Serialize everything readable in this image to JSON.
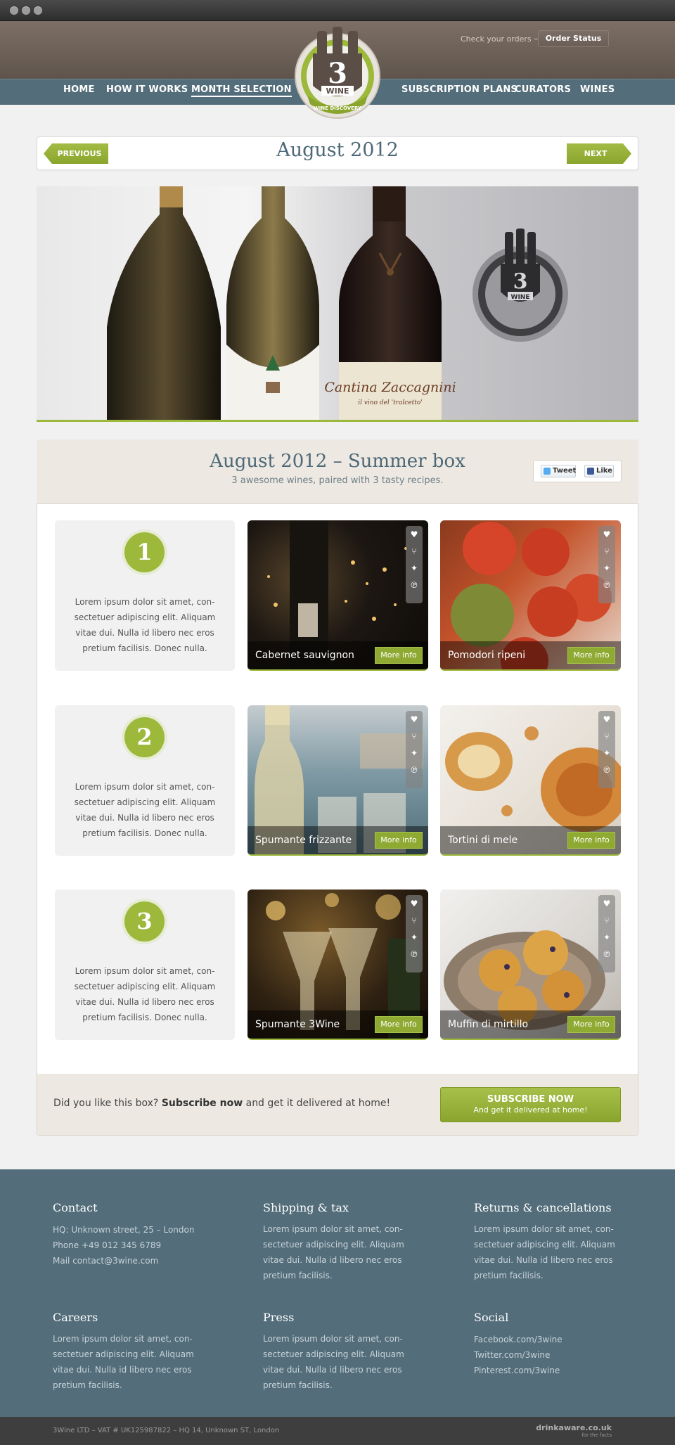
{
  "header": {
    "order_hint": "Check your orders →",
    "order_button": "Order Status",
    "logo_text": "3",
    "logo_word": "WINE",
    "logo_ribbon": "WINE DISCOVERY"
  },
  "nav": {
    "items": [
      "HOME",
      "HOW IT WORKS",
      "MONTH SELECTION",
      "SUBSCRIPTION PLANS",
      "CURATORS",
      "WINES"
    ],
    "active": "MONTH SELECTION"
  },
  "month_bar": {
    "prev": "PREVIOUS",
    "title": "August 2012",
    "next": "NEXT"
  },
  "hero": {
    "label_1": "Cantina Zaccagnini",
    "label_2": "il vino del 'tralcetto'",
    "badge_num": "3",
    "badge_word": "WINE"
  },
  "box": {
    "title": "August 2012 – Summer box",
    "subtitle": "3 awesome wines, paired with 3 tasty recipes.",
    "tweet": "Tweet",
    "like": "Like"
  },
  "steps": [
    {
      "num": "1",
      "text": "Lorem ipsum dolor sit amet, con-sectetuer adipiscing elit. Aliquam vitae dui. Nulla id libero nec eros pretium facilisis. Donec nulla.",
      "wine": "Cabernet sauvignon",
      "food": "Pomodori ripeni"
    },
    {
      "num": "2",
      "text": "Lorem ipsum dolor sit amet, con-sectetuer adipiscing elit. Aliquam vitae dui. Nulla id libero nec eros pretium facilisis. Donec nulla.",
      "wine": "Spumante frizzante",
      "food": "Tortini di mele"
    },
    {
      "num": "3",
      "text": "Lorem ipsum dolor sit amet, con-sectetuer adipiscing elit. Aliquam vitae dui. Nulla id libero nec eros pretium facilisis. Donec nulla.",
      "wine": "Spumante 3Wine",
      "food": "Muffin di mirtillo"
    }
  ],
  "more_info": "More info",
  "tile_icons": [
    "heart-icon",
    "fork-icon",
    "twitter-icon",
    "pinterest-icon"
  ],
  "subscribe": {
    "lead": "Did you like this box?",
    "strong": "Subscribe now",
    "tail": "and get it delivered at home!",
    "button_l1": "SUBSCRIBE NOW",
    "button_l2": "And get it delivered at home!"
  },
  "footer": {
    "contact": {
      "title": "Contact",
      "hq": "HQ:   Unknown street, 25 – London",
      "phone": "Phone   +49 012 345 6789",
      "mail": "Mail   contact@3wine.com"
    },
    "shipping": {
      "title": "Shipping & tax",
      "text": "Lorem ipsum dolor sit amet, con-sectetuer adipiscing elit. Aliquam vitae dui. Nulla id libero nec eros pretium facilisis."
    },
    "returns": {
      "title": "Returns & cancellations",
      "text": "Lorem ipsum dolor sit amet, con-sectetuer adipiscing elit. Aliquam vitae dui. Nulla id libero nec eros pretium facilisis."
    },
    "careers": {
      "title": "Careers",
      "text": "Lorem ipsum dolor sit amet, con-sectetuer adipiscing elit. Aliquam vitae dui. Nulla id libero nec eros pretium facilisis."
    },
    "press": {
      "title": "Press",
      "text": "Lorem ipsum dolor sit amet, con-sectetuer adipiscing elit. Aliquam vitae dui. Nulla id libero nec eros pretium facilisis."
    },
    "social": {
      "title": "Social",
      "links": [
        "Facebook.com/3wine",
        "Twitter.com/3wine",
        "Pinterest.com/3wine"
      ]
    },
    "legal": "3Wine LTD – VAT # UK125987822 – HQ 14, Unknown ST, London",
    "drinkaware": "drinkaware.co.uk",
    "drinkaware_sub": "for the facts"
  },
  "colors": {
    "accent_green": "#9db93b",
    "nav_blue": "#536d7a",
    "header_brown": "#6f635a",
    "title_blue": "#4d6877"
  }
}
